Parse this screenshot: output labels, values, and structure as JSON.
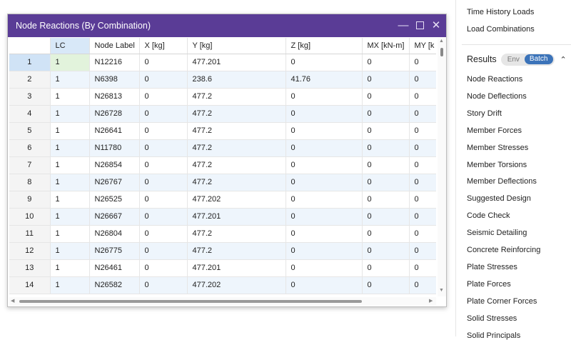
{
  "dialog": {
    "title": "Node Reactions (By Combination)",
    "columns": [
      "",
      "LC",
      "Node Label",
      "X [kg]",
      "Y [kg]",
      "Z [kg]",
      "MX [kN-m]",
      "MY [k"
    ],
    "rows": [
      [
        "1",
        "1",
        "N12216",
        "0",
        "477.201",
        "0",
        "0",
        "0"
      ],
      [
        "2",
        "1",
        "N6398",
        "0",
        "238.6",
        "41.76",
        "0",
        "0"
      ],
      [
        "3",
        "1",
        "N26813",
        "0",
        "477.2",
        "0",
        "0",
        "0"
      ],
      [
        "4",
        "1",
        "N26728",
        "0",
        "477.2",
        "0",
        "0",
        "0"
      ],
      [
        "5",
        "1",
        "N26641",
        "0",
        "477.2",
        "0",
        "0",
        "0"
      ],
      [
        "6",
        "1",
        "N11780",
        "0",
        "477.2",
        "0",
        "0",
        "0"
      ],
      [
        "7",
        "1",
        "N26854",
        "0",
        "477.2",
        "0",
        "0",
        "0"
      ],
      [
        "8",
        "1",
        "N26767",
        "0",
        "477.2",
        "0",
        "0",
        "0"
      ],
      [
        "9",
        "1",
        "N26525",
        "0",
        "477.202",
        "0",
        "0",
        "0"
      ],
      [
        "10",
        "1",
        "N26667",
        "0",
        "477.201",
        "0",
        "0",
        "0"
      ],
      [
        "11",
        "1",
        "N26804",
        "0",
        "477.2",
        "0",
        "0",
        "0"
      ],
      [
        "12",
        "1",
        "N26775",
        "0",
        "477.2",
        "0",
        "0",
        "0"
      ],
      [
        "13",
        "1",
        "N26461",
        "0",
        "477.201",
        "0",
        "0",
        "0"
      ],
      [
        "14",
        "1",
        "N26582",
        "0",
        "477.202",
        "0",
        "0",
        "0"
      ]
    ]
  },
  "right_panel": {
    "top_items": [
      "Time History Loads",
      "Load Combinations"
    ],
    "results_title": "Results",
    "toggle_env": "Env",
    "toggle_batch": "Batch",
    "result_items": [
      "Node Reactions",
      "Node Deflections",
      "Story Drift",
      "Member Forces",
      "Member Stresses",
      "Member Torsions",
      "Member Deflections",
      "Suggested Design",
      "Code Check",
      "Seismic Detailing",
      "Concrete Reinforcing",
      "Plate Stresses",
      "Plate Forces",
      "Plate Corner Forces",
      "Solid Stresses",
      "Solid Principals"
    ]
  },
  "colors": {
    "title_bar": "#5a3c96",
    "accent_blue": "#3b73b9",
    "row_alt": "#eef5fc"
  }
}
